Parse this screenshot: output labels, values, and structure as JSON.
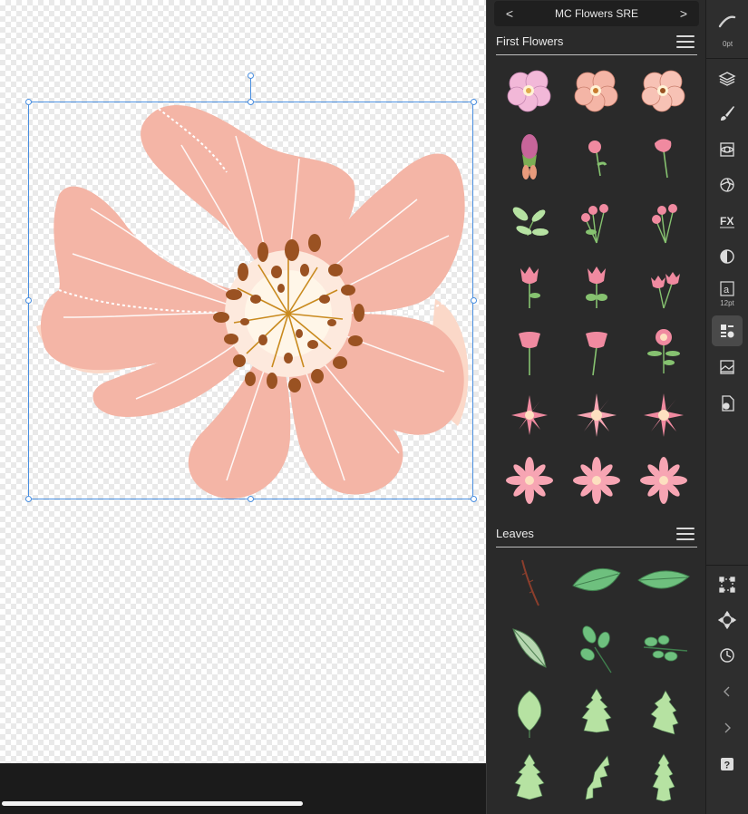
{
  "panel": {
    "title": "MC Flowers SRE",
    "prev_label": "<",
    "next_label": ">",
    "sections": [
      {
        "title": "First Flowers",
        "asset_count": 18
      },
      {
        "title": "Leaves",
        "asset_count": 12
      }
    ]
  },
  "toolbar": {
    "stroke_width": "0pt",
    "text_size": "12pt",
    "tools": [
      "layers-icon",
      "brush-icon",
      "adjustments-icon",
      "effects-icon",
      "fx-icon",
      "styles-icon",
      "text-styles-icon",
      "assets-icon",
      "stock-icon",
      "document-settings-icon",
      "transform-icon",
      "navigator-icon",
      "history-icon",
      "collapse-left-icon",
      "collapse-right-icon",
      "help-icon"
    ]
  },
  "colors": {
    "petal": "#f4b5a6",
    "petal_light": "#fbd8c8",
    "stamen": "#9a5222",
    "selection": "#4a8fe0",
    "leaf_green": "#6ec07e",
    "leaf_light": "#b6e2a2"
  }
}
